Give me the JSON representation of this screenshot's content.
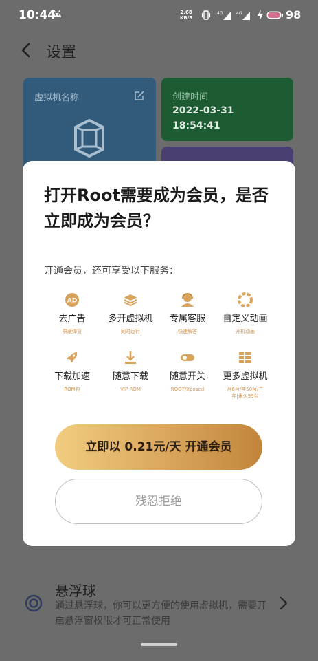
{
  "status_bar": {
    "time": "10:44",
    "net_speed_value": "2.68",
    "net_speed_unit": "KB/S",
    "signal1_label": "4G",
    "signal2_label": "4G",
    "battery_level": "98"
  },
  "header": {
    "title": "设置"
  },
  "cards": {
    "vm_name_label": "虚拟机名称",
    "created_label": "创建时间",
    "created_date": "2022-03-31",
    "created_time": "18:54:41"
  },
  "dialog": {
    "title": "打开Root需要成为会员，是否立即成为会员？",
    "subtitle": "开通会员，还可享受以下服务：",
    "features": [
      {
        "icon": "ad-icon",
        "label": "去广告",
        "sub": "屏蔽弹窗"
      },
      {
        "icon": "layers-icon",
        "label": "多开虚拟机",
        "sub": "同时运行"
      },
      {
        "icon": "support-agent-icon",
        "label": "专属客服",
        "sub": "快速解答"
      },
      {
        "icon": "animation-icon",
        "label": "自定义动画",
        "sub": "开机动画"
      },
      {
        "icon": "rocket-icon",
        "label": "下载加速",
        "sub": "ROM包"
      },
      {
        "icon": "download-icon",
        "label": "随意下载",
        "sub": "VIP ROM"
      },
      {
        "icon": "toggle-icon",
        "label": "随意开关",
        "sub": "ROOT/Xposed"
      },
      {
        "icon": "grid-icon",
        "label": "更多虚拟机",
        "sub": "月6台/年50台/三年|永久99台"
      }
    ],
    "cta_label": "立即以 0.21元/天 开通会员",
    "reject_label": "残忍拒绝"
  },
  "float_ball": {
    "title": "悬浮球",
    "description": "通过悬浮球，你可以更方便的使用虚拟机，需要开启悬浮窗权限才可正常使用"
  },
  "colors": {
    "accent_gold_start": "#f2cd7f",
    "accent_gold_end": "#c1853b",
    "feature_sub_text": "#d29552"
  }
}
